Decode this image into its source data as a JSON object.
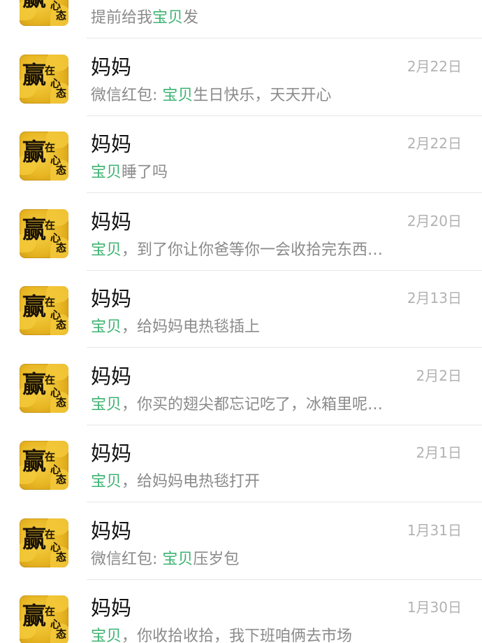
{
  "conversations": [
    {
      "name": "",
      "date": "",
      "prefix": "提前给我",
      "highlight": "宝贝",
      "suffix": "发"
    },
    {
      "name": "妈妈",
      "date": "2月22日",
      "prefix": "微信红包: ",
      "highlight": "宝贝",
      "suffix": "生日快乐，天天开心"
    },
    {
      "name": "妈妈",
      "date": "2月22日",
      "prefix": "",
      "highlight": "宝贝",
      "suffix": "睡了吗"
    },
    {
      "name": "妈妈",
      "date": "2月20日",
      "prefix": "",
      "highlight": "宝贝",
      "suffix": "，到了你让你爸等你一会收拾完东西…"
    },
    {
      "name": "妈妈",
      "date": "2月13日",
      "prefix": "",
      "highlight": "宝贝",
      "suffix": "，给妈妈电热毯插上"
    },
    {
      "name": "妈妈",
      "date": "2月2日",
      "prefix": "",
      "highlight": "宝贝",
      "suffix": "，你买的翅尖都忘记吃了，冰箱里呢…"
    },
    {
      "name": "妈妈",
      "date": "2月1日",
      "prefix": "",
      "highlight": "宝贝",
      "suffix": "，给妈妈电热毯打开"
    },
    {
      "name": "妈妈",
      "date": "1月31日",
      "prefix": "微信红包: ",
      "highlight": "宝贝",
      "suffix": "压岁包"
    },
    {
      "name": "妈妈",
      "date": "1月30日",
      "prefix": "",
      "highlight": "宝贝",
      "suffix": "，你收拾收拾，我下班咱俩去市场"
    }
  ],
  "avatar": {
    "main_char": "赢",
    "small_chars": [
      "在",
      "心",
      "态"
    ],
    "icon": "avatar-image"
  },
  "colors": {
    "highlight": "#3cb371",
    "name": "#111111",
    "date": "#b2b2b2",
    "message": "#8a8a8a",
    "divider": "#e6e6e6"
  }
}
